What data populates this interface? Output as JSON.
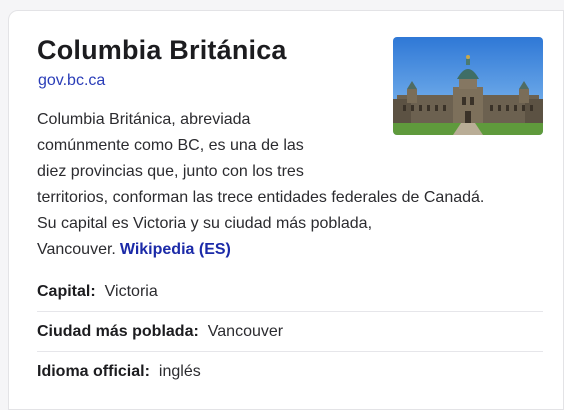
{
  "entity": {
    "title": "Columbia Británica",
    "site": "gov.bc.ca",
    "image_alt": "Edificio del Parlamento de Columbia Británica"
  },
  "description": {
    "lines": [
      "Columbia Británica, abreviada",
      "comúnmente como BC, es una de las",
      "diez provincias que, junto con los tres",
      "territorios, conforman las trece entidades federales de Canadá.",
      "Su capital es Victoria y su ciudad más poblada,",
      "Vancouver."
    ],
    "source_link": "Wikipedia (ES)"
  },
  "facts": [
    {
      "label": "Capital:",
      "value": "Victoria"
    },
    {
      "label": "Ciudad más poblada:",
      "value": "Vancouver"
    },
    {
      "label": "Idioma official:",
      "value": "inglés"
    }
  ],
  "colors": {
    "link": "#2a3db8",
    "source_link": "#1b2aa8",
    "title": "#1c1c1f"
  }
}
